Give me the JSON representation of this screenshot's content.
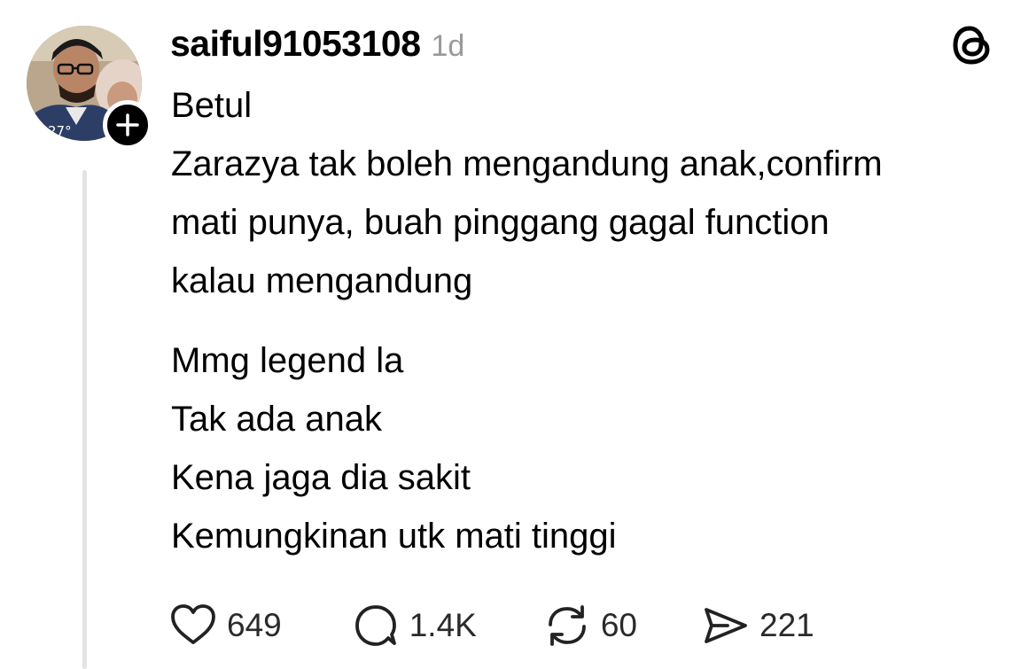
{
  "post": {
    "username": "saiful91053108",
    "time": "1d",
    "avatar_badge": "27°",
    "paragraphs": [
      [
        "Betul",
        "Zarazya tak boleh mengandung anak,confirm",
        "mati punya, buah pinggang gagal function",
        "kalau mengandung"
      ],
      [
        "Mmg legend la",
        "Tak ada anak",
        "Kena jaga dia sakit",
        "Kemungkinan utk mati tinggi"
      ]
    ]
  },
  "actions": {
    "likes": "649",
    "replies": "1.4K",
    "reposts": "60",
    "shares": "221"
  },
  "icons": {
    "like": "heart-icon",
    "reply": "speech-bubble-icon",
    "repost": "repost-icon",
    "share": "send-icon",
    "follow": "plus-icon",
    "logo": "threads-logo-icon"
  }
}
